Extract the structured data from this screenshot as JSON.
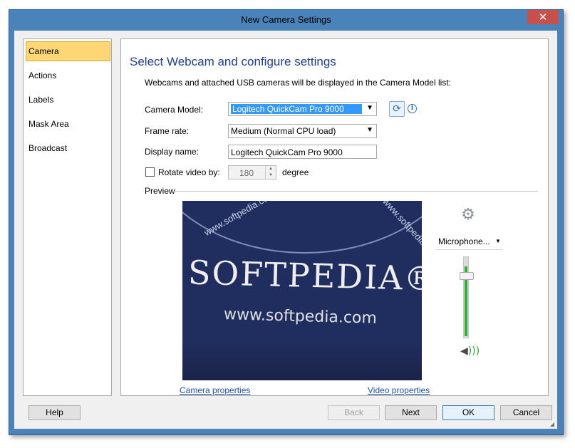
{
  "window": {
    "title": "New Camera Settings",
    "close_glyph": "✕"
  },
  "sidebar": {
    "items": [
      {
        "label": "Camera",
        "selected": true
      },
      {
        "label": "Actions"
      },
      {
        "label": "Labels"
      },
      {
        "label": "Mask Area"
      },
      {
        "label": "Broadcast"
      }
    ]
  },
  "main": {
    "heading": "Select Webcam and configure settings",
    "intro": "Webcams and attached USB cameras will be displayed in the Camera Model list:",
    "camera_model": {
      "label": "Camera Model:",
      "value": "Logitech QuickCam Pro 9000"
    },
    "frame_rate": {
      "label": "Frame rate:",
      "value": "Medium (Normal CPU load)"
    },
    "display_name": {
      "label": "Display name:",
      "value": "Logitech QuickCam Pro 9000"
    },
    "rotate": {
      "label": "Rotate video by:",
      "value": "180",
      "unit": "degree",
      "checked": false
    },
    "preview": {
      "label": "Preview",
      "video_brand": "SOFTPEDIA®",
      "video_url": "www.softpedia.com",
      "video_text_top": "www.softpedia.com",
      "video_text_right": "www.softpedia"
    },
    "camera_properties_link": "Camera properties",
    "video_properties_link": "Video properties",
    "microphone": {
      "value": "Microphone...",
      "level": 0.9
    }
  },
  "icons": {
    "refresh": "refresh-icon",
    "info": "info-icon",
    "gear": "gear-icon",
    "speaker": "speaker-icon",
    "dropdown_arrow": "chevron-down-icon"
  },
  "colors": {
    "title_bar": "#4a83b9",
    "selected_nav": "#fdd675",
    "heading": "#1f3f8e",
    "link": "#1f4fb7",
    "mic_level": "#30b030",
    "close_button": "#c7504b"
  },
  "footer": {
    "help_label": "Help",
    "back_label": "Back",
    "next_label": "Next",
    "ok_label": "OK",
    "cancel_label": "Cancel"
  }
}
